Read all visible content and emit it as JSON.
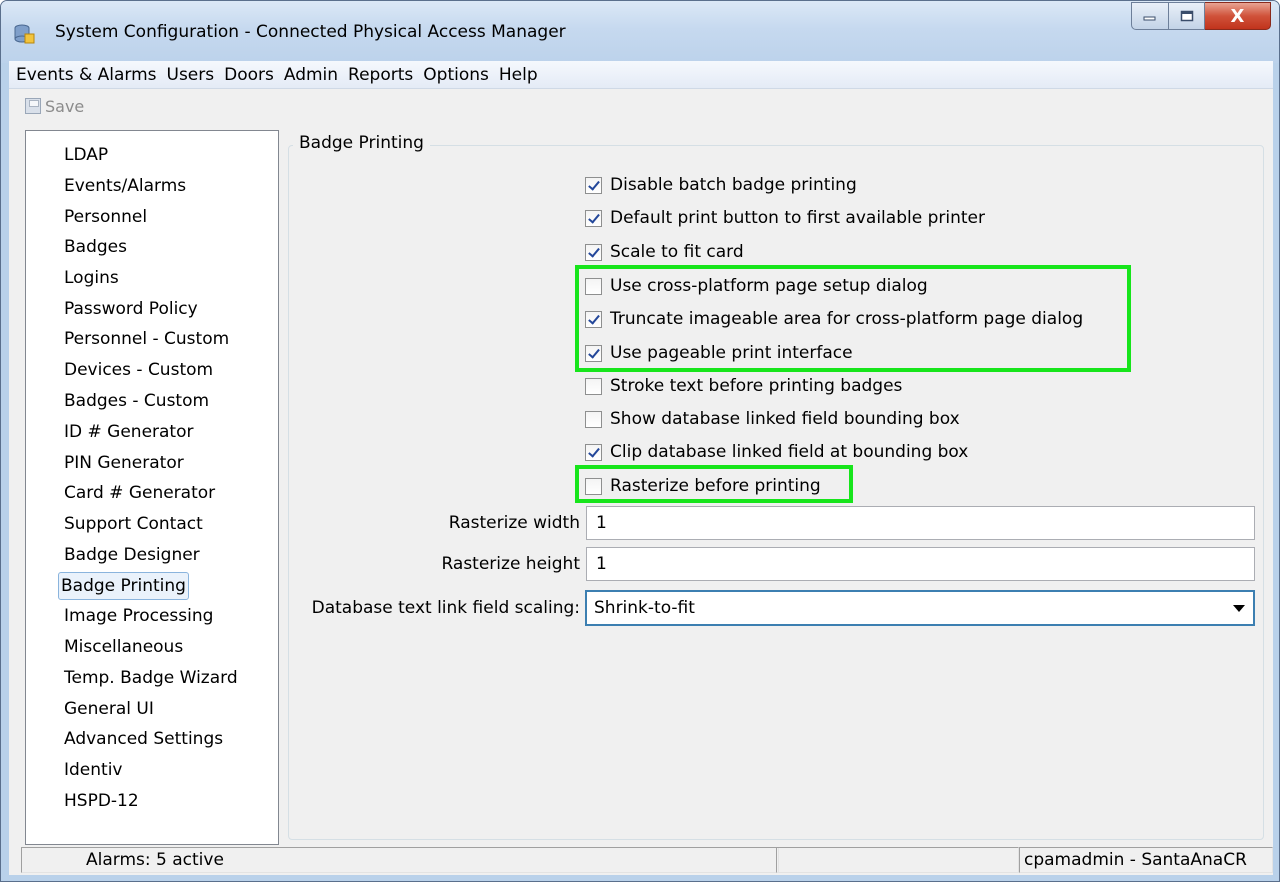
{
  "window": {
    "title": "System Configuration - Connected Physical Access Manager",
    "controls": {
      "minimize": "–",
      "maximize": "□",
      "close": "X"
    }
  },
  "menubar": {
    "items": [
      "Events & Alarms",
      "Users",
      "Doors",
      "Admin",
      "Reports",
      "Options",
      "Help"
    ]
  },
  "toolbar": {
    "save_label": "Save",
    "save_enabled": false
  },
  "sidebar": {
    "selected": "Badge Printing",
    "items": [
      "LDAP",
      "Events/Alarms",
      "Personnel",
      "Badges",
      "Logins",
      "Password Policy",
      "Personnel - Custom",
      "Devices - Custom",
      "Badges - Custom",
      "ID # Generator",
      "PIN Generator",
      "Card # Generator",
      "Support Contact",
      "Badge Designer",
      "Badge Printing",
      "Image Processing",
      "Miscellaneous",
      "Temp. Badge Wizard",
      "General UI",
      "Advanced Settings",
      "Identiv",
      "HSPD-12"
    ]
  },
  "panel": {
    "title": "Badge Printing",
    "checkboxes": [
      {
        "label": "Disable batch badge printing",
        "checked": true
      },
      {
        "label": "Default print button to first available printer",
        "checked": true
      },
      {
        "label": "Scale to fit card",
        "checked": true
      },
      {
        "label": "Use cross-platform page setup dialog",
        "checked": false
      },
      {
        "label": "Truncate imageable area for cross-platform page dialog",
        "checked": true
      },
      {
        "label": "Use pageable print interface",
        "checked": true
      },
      {
        "label": "Stroke text before printing badges",
        "checked": false
      },
      {
        "label": "Show database linked field bounding box",
        "checked": false
      },
      {
        "label": "Clip database linked field at bounding box",
        "checked": true
      },
      {
        "label": "Rasterize before printing",
        "checked": false
      }
    ],
    "rasterize_width": {
      "label": "Rasterize width",
      "value": "1"
    },
    "rasterize_height": {
      "label": "Rasterize height",
      "value": "1"
    },
    "db_text_scaling": {
      "label": "Database text link field scaling:",
      "value": "Shrink-to-fit"
    }
  },
  "statusbar": {
    "alarms": "Alarms: 5 active",
    "middle": "",
    "user": "cpamadmin - SantaAnaCR"
  },
  "colors": {
    "highlight": "#17e51b",
    "check": "#23479a",
    "window_frame": "#b9d1ea"
  }
}
